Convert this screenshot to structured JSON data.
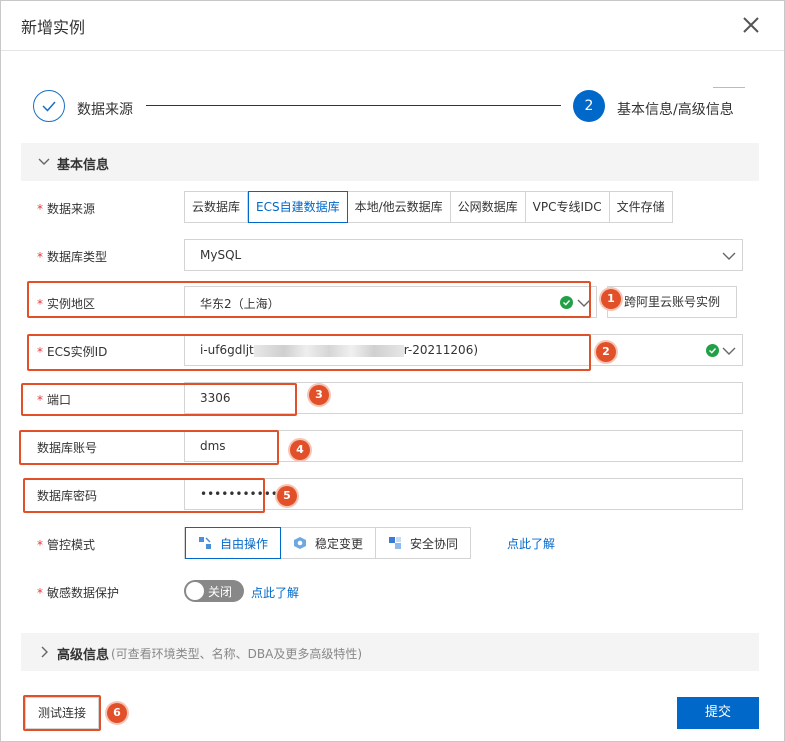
{
  "dialog": {
    "title": "新增实例"
  },
  "steps": [
    {
      "label": "数据来源",
      "state": "done"
    },
    {
      "number": "2",
      "label": "基本信息/高级信息",
      "state": "active"
    }
  ],
  "basic_section": {
    "title": "基本信息"
  },
  "form": {
    "source": {
      "label": "数据来源",
      "options": [
        "云数据库",
        "ECS自建数据库",
        "本地/他云数据库",
        "公网数据库",
        "VPC专线IDC",
        "文件存储"
      ],
      "selected": "ECS自建数据库"
    },
    "db_type": {
      "label": "数据库类型",
      "value": "MySQL"
    },
    "region": {
      "label": "实例地区",
      "value": "华东2（上海）",
      "cross_account_button": "跨阿里云账号实例"
    },
    "ecs_id": {
      "label": "ECS实例ID",
      "value_prefix": "i-uf6gdljt",
      "value_suffix": "r-20211206)"
    },
    "port": {
      "label": "端口",
      "value": "3306"
    },
    "account": {
      "label": "数据库账号",
      "value": "dms"
    },
    "password": {
      "label": "数据库密码",
      "value": "••••••••••••"
    },
    "control_mode": {
      "label": "管控模式",
      "options": [
        "自由操作",
        "稳定变更",
        "安全协同"
      ],
      "selected": "自由操作",
      "learn_more": "点此了解"
    },
    "sensitive": {
      "label": "敏感数据保护",
      "toggle_label": "关闭",
      "learn_more": "点此了解"
    }
  },
  "advanced_section": {
    "title": "高级信息",
    "subtitle": "(可查看环境类型、名称、DBA及更多高级特性)"
  },
  "footer": {
    "test_button": "测试连接",
    "submit_button": "提交"
  },
  "annotations": [
    "1",
    "2",
    "3",
    "4",
    "5",
    "6"
  ],
  "colors": {
    "primary": "#0068c9",
    "annotation": "#e2502a",
    "success": "#22a045",
    "required": "#e4393c"
  }
}
